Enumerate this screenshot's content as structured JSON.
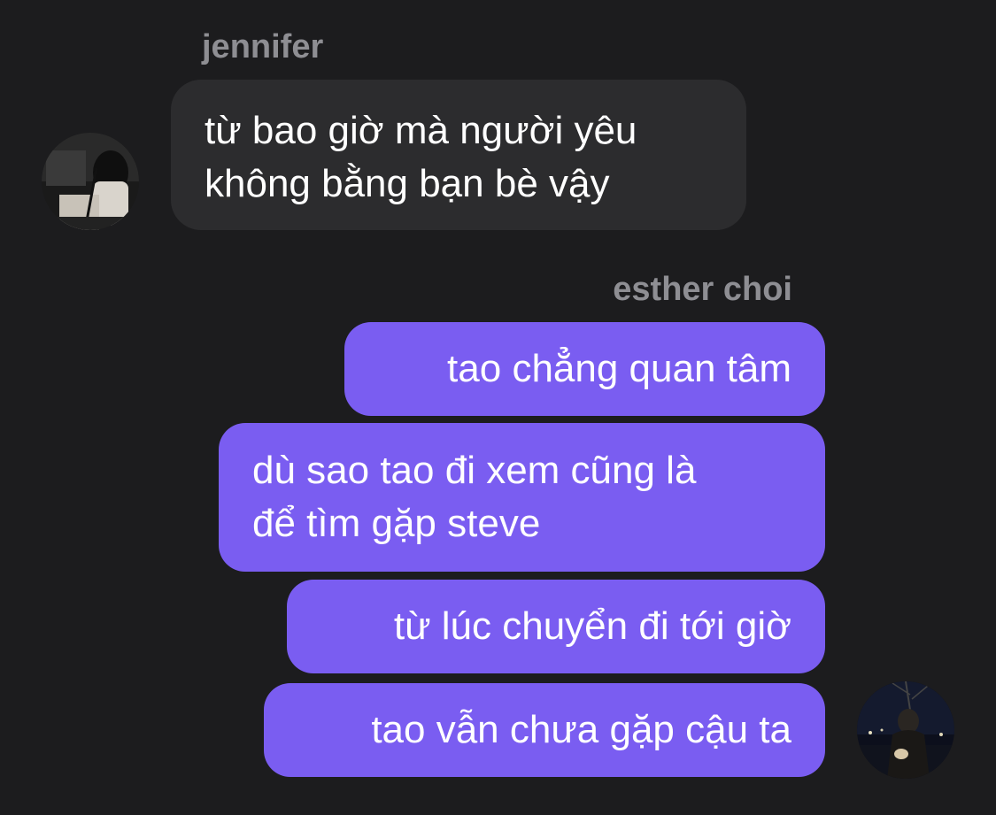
{
  "thread": {
    "incoming": {
      "sender_name": "jennifer",
      "avatar_icon": "jennifer-avatar",
      "bubble_color": "#2c2c2e",
      "messages": [
        {
          "lines": [
            "từ bao giờ mà người yêu",
            "không bằng bạn bè vậy"
          ]
        }
      ]
    },
    "outgoing": {
      "sender_name": "esther choi",
      "avatar_icon": "esther-avatar",
      "bubble_color": "#7a5df1",
      "messages": [
        {
          "lines": [
            "tao chẳng quan tâm"
          ]
        },
        {
          "lines": [
            "dù sao tao đi xem cũng là",
            "để tìm gặp steve"
          ]
        },
        {
          "lines": [
            "từ lúc chuyển đi tới giờ"
          ]
        },
        {
          "lines": [
            "tao vẫn chưa gặp cậu ta"
          ]
        }
      ]
    }
  },
  "colors": {
    "background": "#1c1c1e",
    "name_text": "#8e8e93",
    "message_text": "#ffffff"
  }
}
